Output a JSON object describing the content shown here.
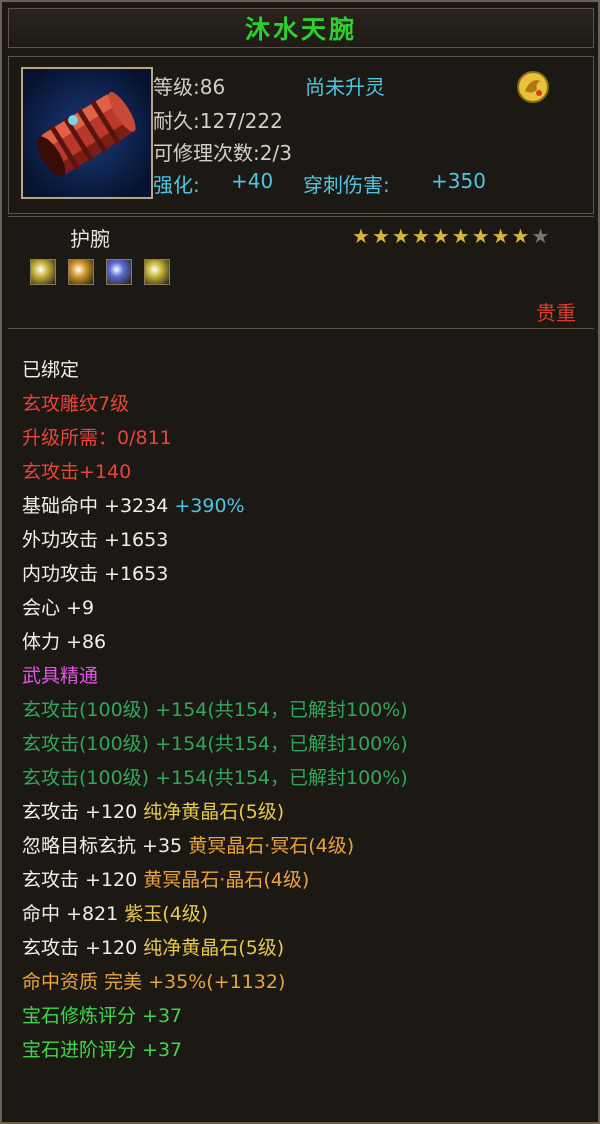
{
  "item": {
    "name": "沐水天腕",
    "level": "等级:86",
    "spirit_status": "尚未升灵",
    "durability": "耐久:127/222",
    "repair": "可修理次数:2/3",
    "enhance_label": "强化:",
    "enhance_value": "+40",
    "pierce_label": "穿刺伤害:",
    "pierce_value": "+350",
    "type": "护腕",
    "rarity": "贵重",
    "stars_filled": 9,
    "stars_total": 10,
    "icon": "red-bracer-icon",
    "badge_icon": "gold-crest-icon"
  },
  "gems": [
    {
      "name": "gold-gem-icon",
      "color": "#c8b43a"
    },
    {
      "name": "amber-gem-icon",
      "color": "#d49a2a"
    },
    {
      "name": "blue-gem-icon",
      "color": "#5a6ad8"
    },
    {
      "name": "gold-gem-icon",
      "color": "#c8b43a"
    }
  ],
  "colors": {
    "title": "#2fcf2f",
    "rarity": "#e23a2a",
    "cyan": "#4fc5e3",
    "red": "#e8443a",
    "pink": "#e454e4",
    "green": "#2ea85a",
    "orange": "#e8a43a",
    "bright_green": "#3ed84a"
  },
  "attributes": {
    "bound": "已绑定",
    "engrave": "玄攻雕纹7级",
    "upgrade_need": "升级所需：0/811",
    "xuan_attack": "玄攻击+140",
    "hit_base": "基础命中 +3234",
    "hit_base_pct": "+390%",
    "outer_attack": "外功攻击 +1653",
    "inner_attack": "内功攻击 +1653",
    "crit": "会心 +9",
    "stamina": "体力 +86",
    "mastery": "武具精通",
    "seal_1": "玄攻击(100级) +154(共154，已解封100%)",
    "seal_2": "玄攻击(100级) +154(共154，已解封100%)",
    "seal_3": "玄攻击(100级) +154(共154，已解封100%)",
    "gem_line_1_stat": "玄攻击 +120",
    "gem_line_1_gem": "纯净黄晶石(5级)",
    "gem_line_2_stat": "忽略目标玄抗 +35",
    "gem_line_2_gem": "黄冥晶石·冥石(4级)",
    "gem_line_3_stat": "玄攻击 +120",
    "gem_line_3_gem": "黄冥晶石·晶石(4级)",
    "gem_line_4_stat": "命中 +821",
    "gem_line_4_gem": "紫玉(4级)",
    "gem_line_5_stat": "玄攻击 +120",
    "gem_line_5_gem": "纯净黄晶石(5级)",
    "quality_label": "命中资质",
    "quality_value": "完美 +35%(+1132)",
    "gem_refine": "宝石修炼评分 +37",
    "gem_advance": "宝石进阶评分 +37"
  }
}
